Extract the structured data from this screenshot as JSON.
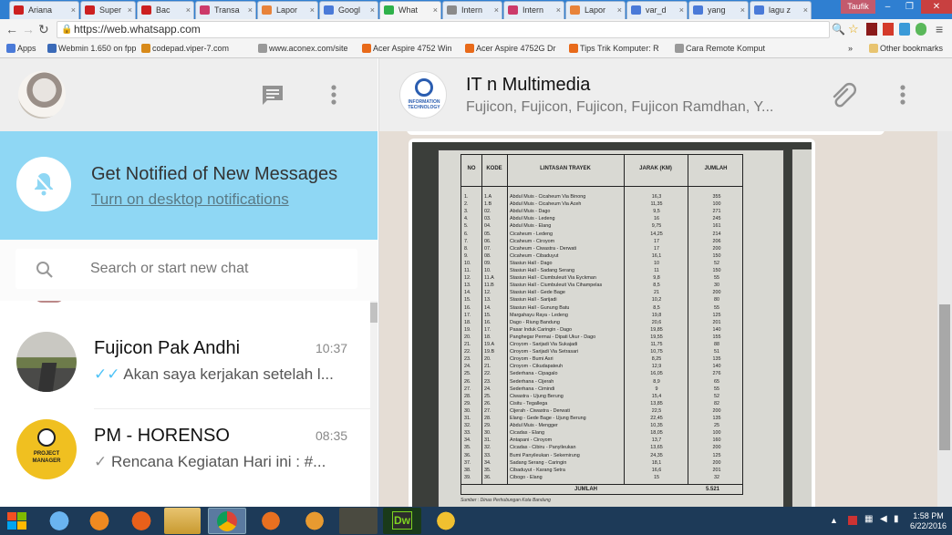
{
  "browser": {
    "tabs": [
      {
        "label": "Ariana",
        "color": "#cc2020"
      },
      {
        "label": "Super",
        "color": "#cc2020"
      },
      {
        "label": "Bac",
        "color": "#cc2020"
      },
      {
        "label": "Transa",
        "color": "#cc3a6a"
      },
      {
        "label": "Lapor",
        "color": "#e8833a"
      },
      {
        "label": "Googl",
        "color": "#4a7ad8"
      },
      {
        "label": "What",
        "color": "#2fb14a"
      },
      {
        "label": "Intern",
        "color": "#8a8a8a"
      },
      {
        "label": "Intern",
        "color": "#cc3a6a"
      },
      {
        "label": "Lapor",
        "color": "#e8833a"
      },
      {
        "label": "var_d",
        "color": "#4a7ad8"
      },
      {
        "label": "yang",
        "color": "#4a7ad8"
      },
      {
        "label": "lagu z",
        "color": "#4a7ad8"
      }
    ],
    "profile_name": "Taufik",
    "url": "https://web.whatsapp.com",
    "bookmarks": [
      {
        "label": "Apps",
        "color": "#4a7ad8"
      },
      {
        "label": "Webmin 1.650 on fpp",
        "color": "#3a6ab8"
      },
      {
        "label": "codepad.viper-7.com",
        "color": "#d88a1a"
      },
      {
        "label": "www.aconex.com/site",
        "color": "#999999"
      },
      {
        "label": "Acer Aspire 4752 Win",
        "color": "#e86a1a"
      },
      {
        "label": "Acer Aspire 4752G Dr",
        "color": "#e86a1a"
      },
      {
        "label": "Tips Trik Komputer: R",
        "color": "#e86a1a"
      },
      {
        "label": "Cara Remote Komput",
        "color": "#999999"
      }
    ],
    "other_bookmarks": "Other bookmarks"
  },
  "whatsapp": {
    "notice_title": "Get Notified of New Messages",
    "notice_link": "Turn on desktop notifications",
    "search_placeholder": "Search or start new chat",
    "chats": [
      {
        "name": "Fujicon Pak Andhi",
        "time": "10:37",
        "preview": "Akan saya kerjakan setelah l...",
        "tick": "✓✓",
        "tick_color": "#4fc3f7"
      },
      {
        "name": "PM - HORENSO",
        "time": "08:35",
        "preview": "Rencana Kegiatan Hari ini : #...",
        "tick": "✓",
        "tick_color": "#919191"
      }
    ],
    "project_manager_avatar": "PROJECT MANAGER",
    "group_logo_text": "INFORMATION TECHNOLOGY",
    "group_name": "IT n Multimedia",
    "group_members": "Fujicon, Fujicon, Fujicon, Fujicon Ramdhan, Y...",
    "document": {
      "headers": [
        "NO",
        "KODE",
        "LINTASAN TRAYEK",
        "JARAK (KM)",
        "JUMLAH"
      ],
      "footer_label": "JUMLAH",
      "footer_total": "5.521",
      "source_note": "Sumber : Dinas Perhubungan Kota Bandung",
      "rows": [
        [
          "1.",
          "1.A",
          "Abdul Muis - Cicaheum Via Binong",
          "16,3",
          "355"
        ],
        [
          "2.",
          "1.B",
          "Abdul Muis - Cicaheum Via Aceh",
          "11,35",
          "100"
        ],
        [
          "3.",
          "02.",
          "Abdul Muis - Dago",
          "9,5",
          "271"
        ],
        [
          "4.",
          "03.",
          "Abdul Muis - Ledeng",
          "16",
          "245"
        ],
        [
          "5.",
          "04.",
          "Abdul Muis - Elang",
          "9,75",
          "161"
        ],
        [
          "6.",
          "05.",
          "Cicaheum - Ledeng",
          "14,25",
          "214"
        ],
        [
          "7.",
          "06.",
          "Cicaheum - Ciroyom",
          "17",
          "206"
        ],
        [
          "8.",
          "07.",
          "Cicaheum - Ciwastra - Derwati",
          "17",
          "200"
        ],
        [
          "9.",
          "08.",
          "Cicaheum - Cibaduyut",
          "16,1",
          "150"
        ],
        [
          "10.",
          "09.",
          "Stasiun Hall - Dago",
          "10",
          "52"
        ],
        [
          "11.",
          "10.",
          "Stasiun Hall - Sadang Serang",
          "11",
          "150"
        ],
        [
          "12.",
          "11.A",
          "Stasiun Hall - Ciumbuleuit Via Eyckman",
          "9,8",
          "55"
        ],
        [
          "13.",
          "11.B",
          "Stasiun Hall - Ciumbuleuit Via Cihampelas",
          "8,5",
          "30"
        ],
        [
          "14.",
          "12.",
          "Stasiun Hall - Gede Bage",
          "21",
          "200"
        ],
        [
          "15.",
          "13.",
          "Stasiun Hall - Sarijadi",
          "10,2",
          "80"
        ],
        [
          "16.",
          "14.",
          "Stasiun Hall - Gunung Batu",
          "8,5",
          "55"
        ],
        [
          "17.",
          "15.",
          "Margahayu Raya - Ledeng",
          "19,8",
          "125"
        ],
        [
          "18.",
          "16.",
          "Dago - Riung Bandung",
          "20,6",
          "201"
        ],
        [
          "19.",
          "17.",
          "Pasar Induk Caringin - Dago",
          "19,85",
          "140"
        ],
        [
          "20.",
          "18.",
          "Panghegar Permai - Dipati Ukur - Dago",
          "19,55",
          "155"
        ],
        [
          "21.",
          "19.A",
          "Ciroyom - Sarijadi Via Sukajadi",
          "11,75",
          "88"
        ],
        [
          "22.",
          "19.B",
          "Ciroyom - Sarijadi Via Setrasari",
          "10,75",
          "51"
        ],
        [
          "23.",
          "20.",
          "Ciroyom - Bumi Asri",
          "8,25",
          "135"
        ],
        [
          "24.",
          "21.",
          "Ciroyom - Cikudapateuh",
          "12,9",
          "140"
        ],
        [
          "25.",
          "22.",
          "Sederhana - Cipagalo",
          "16,05",
          "276"
        ],
        [
          "26.",
          "23.",
          "Sederhana - Cijerah",
          "8,9",
          "65"
        ],
        [
          "27.",
          "24.",
          "Sederhana - Cimindi",
          "9",
          "55"
        ],
        [
          "28.",
          "25.",
          "Ciwastra - Ujung Berung",
          "15,4",
          "52"
        ],
        [
          "29.",
          "26.",
          "Cisitu - Tegallega",
          "13,85",
          "82"
        ],
        [
          "30.",
          "27.",
          "Cijerah - Ciwastra - Derwati",
          "22,5",
          "200"
        ],
        [
          "31.",
          "28.",
          "Elang - Gede Bage - Ujung Berung",
          "22,45",
          "135"
        ],
        [
          "32.",
          "29.",
          "Abdul Muis - Mengger",
          "10,35",
          "25"
        ],
        [
          "33.",
          "30.",
          "Cicadas - Elang",
          "18,05",
          "100"
        ],
        [
          "34.",
          "31.",
          "Antapani - Ciroyom",
          "13,7",
          "160"
        ],
        [
          "35.",
          "32.",
          "Cicadas - Cibiru - Panyileukan",
          "13,65",
          "200"
        ],
        [
          "36.",
          "33.",
          "Bumi Panyileukan - Sekemirung",
          "24,35",
          "125"
        ],
        [
          "37.",
          "34.",
          "Sadang Serang - Caringin",
          "18,1",
          "200"
        ],
        [
          "38.",
          "35.",
          "Cibaduyut - Karang Setra",
          "16,6",
          "201"
        ],
        [
          "39.",
          "36.",
          "Cibogo - Elang",
          "15",
          "32"
        ]
      ]
    }
  },
  "system": {
    "time": "1:58 PM",
    "date": "6/22/2016"
  }
}
